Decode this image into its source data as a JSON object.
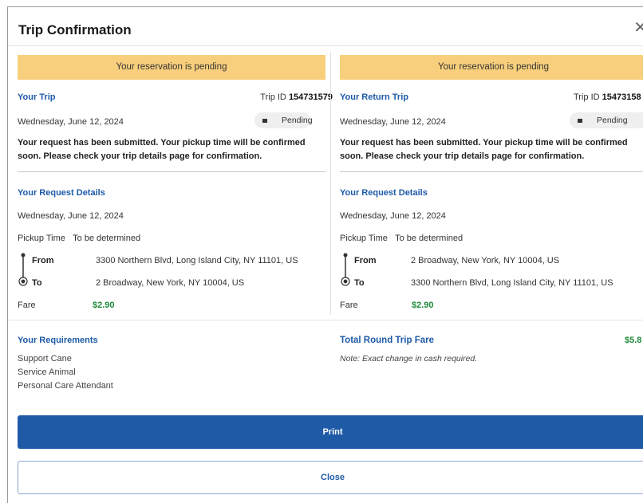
{
  "dialog": {
    "title": "Trip Confirmation",
    "close_icon": "close-icon"
  },
  "outbound": {
    "banner": "Your reservation is pending",
    "heading": "Your Trip",
    "trip_id_label": "Trip ID",
    "trip_id": "154731579",
    "date": "Wednesday, June 12, 2024",
    "status": "Pending",
    "message": "Your request has been submitted. Your pickup time will be confirmed soon. Please check your trip details page for confirmation.",
    "details_heading": "Your Request Details",
    "details_date": "Wednesday, June 12, 2024",
    "pickup_label": "Pickup Time",
    "pickup_value": "To be determined",
    "from_label": "From",
    "from_value": "3300 Northern Blvd, Long Island City, NY 11101, US",
    "to_label": "To",
    "to_value": "2 Broadway, New York, NY 10004, US",
    "fare_label": "Fare",
    "fare_value": "$2.90"
  },
  "return": {
    "banner": "Your reservation is pending",
    "heading": "Your Return Trip",
    "trip_id_label": "Trip ID",
    "trip_id": "15473158",
    "date": "Wednesday, June 12, 2024",
    "status": "Pending",
    "message": "Your request has been submitted. Your pickup time will be confirmed soon. Please check your trip details page for confirmation.",
    "details_heading": "Your Request Details",
    "details_date": "Wednesday, June 12, 2024",
    "pickup_label": "Pickup Time",
    "pickup_value": "To be determined",
    "from_label": "From",
    "from_value": "2 Broadway, New York, NY 10004, US",
    "to_label": "To",
    "to_value": "3300 Northern Blvd, Long Island City, NY 11101, US",
    "fare_label": "Fare",
    "fare_value": "$2.90"
  },
  "requirements": {
    "heading": "Your Requirements",
    "items": [
      "Support Cane",
      "Service Animal",
      "Personal Care Attendant"
    ]
  },
  "total": {
    "label": "Total Round Trip Fare",
    "value": "$5.8",
    "note": "Note: Exact change in cash required."
  },
  "buttons": {
    "print": "Print",
    "close": "Close"
  },
  "colors": {
    "banner": "#f8cf7c",
    "primary": "#1e5aa6",
    "fare": "#1f8a3b"
  }
}
